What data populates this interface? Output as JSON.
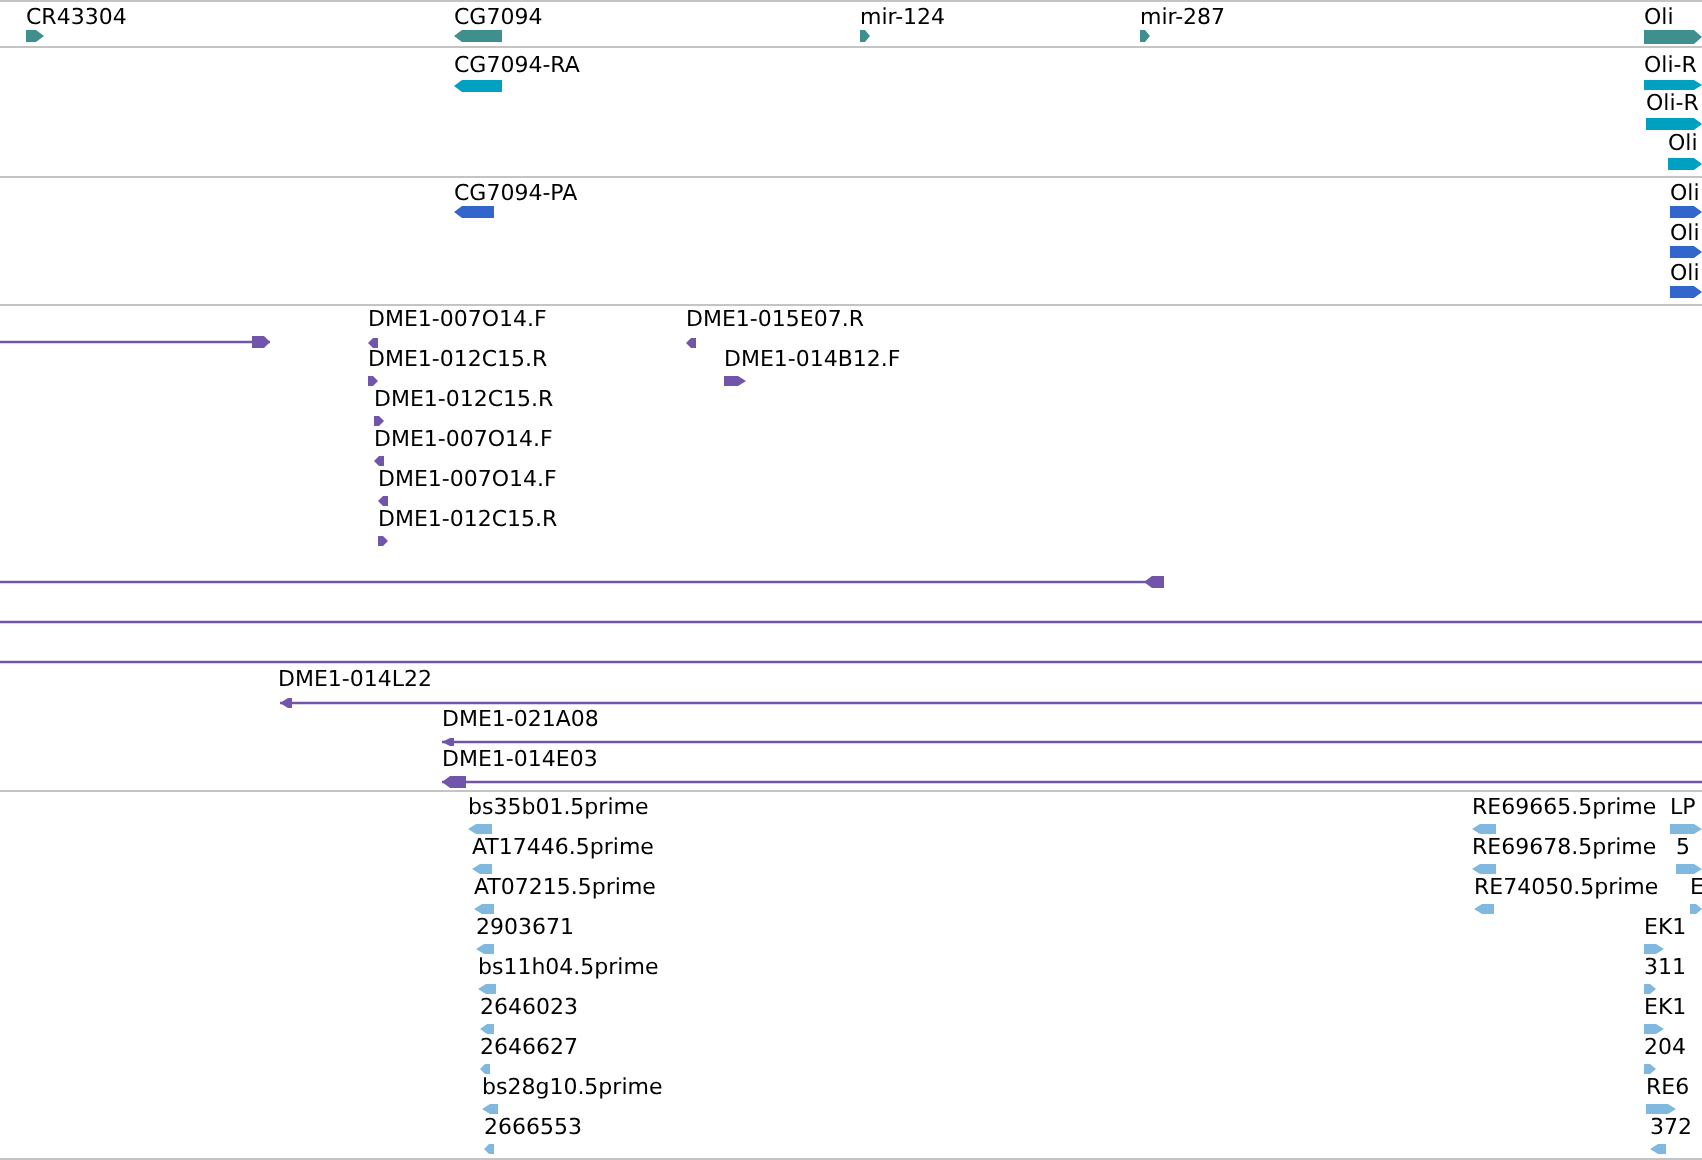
{
  "tracks": [
    {
      "color": "#3f8f8f",
      "features": [
        {
          "kind": "block",
          "label": "CR43304",
          "reverse": false
        },
        {
          "kind": "block",
          "label": "CG7094",
          "reverse": true
        },
        {
          "kind": "block",
          "label": "mir-124",
          "reverse": false
        },
        {
          "kind": "block",
          "label": "mir-287",
          "reverse": false
        },
        {
          "kind": "block",
          "label": "Oli",
          "reverse": false
        }
      ]
    },
    {
      "color": "#00a0c0",
      "features": [
        {
          "kind": "block",
          "label": "CG7094-RA",
          "reverse": true
        },
        {
          "kind": "block",
          "label": "Oli-R",
          "reverse": false
        },
        {
          "kind": "block",
          "label": "Oli-R",
          "reverse": false
        },
        {
          "kind": "block",
          "label": "Oli",
          "reverse": false
        }
      ]
    },
    {
      "color": "#3366cc",
      "features": [
        {
          "kind": "block",
          "label": "CG7094-PA",
          "reverse": true
        },
        {
          "kind": "block",
          "label": "Oli",
          "reverse": false
        },
        {
          "kind": "block",
          "label": "Oli",
          "reverse": false
        },
        {
          "kind": "block",
          "label": "Oli",
          "reverse": false
        }
      ]
    },
    {
      "color": "#7055aa",
      "features": [
        {
          "kind": "line",
          "reverse": false
        },
        {
          "kind": "block",
          "label": "DME1-007O14.F",
          "reverse": true
        },
        {
          "kind": "block",
          "label": "DME1-012C15.R",
          "reverse": false
        },
        {
          "kind": "block",
          "label": "DME1-012C15.R",
          "reverse": false
        },
        {
          "kind": "block",
          "label": "DME1-007O14.F",
          "reverse": true
        },
        {
          "kind": "block",
          "label": "DME1-007O14.F",
          "reverse": true
        },
        {
          "kind": "block",
          "label": "DME1-012C15.R",
          "reverse": false
        },
        {
          "kind": "block",
          "label": "DME1-015E07.R",
          "reverse": true
        },
        {
          "kind": "block",
          "label": "DME1-014B12.F",
          "reverse": false
        },
        {
          "kind": "line",
          "reverse": true
        },
        {
          "kind": "line"
        },
        {
          "kind": "line"
        },
        {
          "kind": "line",
          "label": "DME1-014L22",
          "reverse": true
        },
        {
          "kind": "line",
          "label": "DME1-021A08",
          "reverse": true
        },
        {
          "kind": "line",
          "label": "DME1-014E03",
          "reverse": true
        }
      ]
    },
    {
      "color": "#80b8e0",
      "features": [
        {
          "kind": "block",
          "label": "bs35b01.5prime",
          "reverse": true
        },
        {
          "kind": "block",
          "label": "AT17446.5prime",
          "reverse": true
        },
        {
          "kind": "block",
          "label": "AT07215.5prime",
          "reverse": true
        },
        {
          "kind": "block",
          "label": "2903671",
          "reverse": true
        },
        {
          "kind": "block",
          "label": "bs11h04.5prime",
          "reverse": true
        },
        {
          "kind": "block",
          "label": "2646023",
          "reverse": true
        },
        {
          "kind": "block",
          "label": "2646627",
          "reverse": true
        },
        {
          "kind": "block",
          "label": "bs28g10.5prime",
          "reverse": true
        },
        {
          "kind": "block",
          "label": "2666553",
          "reverse": true
        },
        {
          "kind": "block",
          "label": "RE69665.5prime",
          "reverse": true
        },
        {
          "kind": "block",
          "label": "RE69678.5prime",
          "reverse": true
        },
        {
          "kind": "block",
          "label": "RE74050.5prime",
          "reverse": true
        },
        {
          "kind": "block",
          "label": "LP",
          "reverse": false
        },
        {
          "kind": "block",
          "label": "5",
          "reverse": false
        },
        {
          "kind": "block",
          "label": "E",
          "reverse": false
        },
        {
          "kind": "block",
          "label": "EK1",
          "reverse": false
        },
        {
          "kind": "block",
          "label": "311",
          "reverse": false
        },
        {
          "kind": "block",
          "label": "EK1",
          "reverse": false
        },
        {
          "kind": "block",
          "label": "204",
          "reverse": false
        },
        {
          "kind": "block",
          "label": "RE6",
          "reverse": false
        },
        {
          "kind": "block",
          "label": "372",
          "reverse": true
        }
      ]
    }
  ]
}
